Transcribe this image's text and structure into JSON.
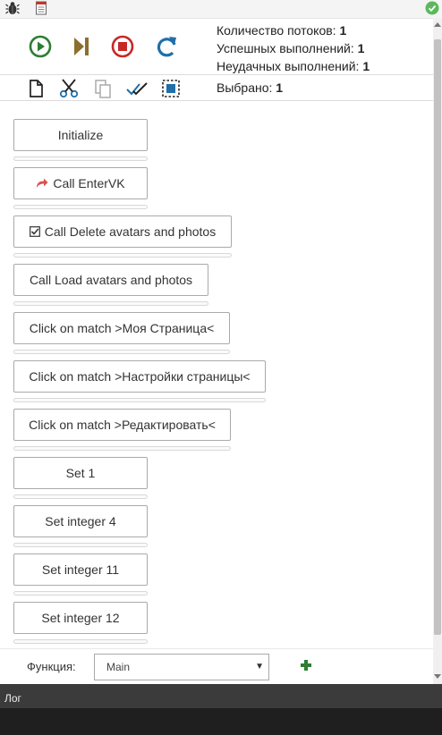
{
  "stats": {
    "threads_label": "Количество потоков:",
    "threads_value": "1",
    "success_label": "Успешных выполнений:",
    "success_value": "1",
    "fail_label": "Неудачных выполнений:",
    "fail_value": "1",
    "selected_label": "Выбрано:",
    "selected_value": "1"
  },
  "steps": [
    {
      "label": "Initialize",
      "icon": ""
    },
    {
      "label": "Call EnterVK",
      "icon": "share-arrow-icon"
    },
    {
      "label": "Call Delete avatars and photos",
      "icon": "checkbox-checked-icon"
    },
    {
      "label": "Call Load avatars and photos",
      "icon": ""
    },
    {
      "label": "Click on match >Моя Страница<",
      "icon": ""
    },
    {
      "label": "Click on match >Настройки страницы<",
      "icon": ""
    },
    {
      "label": "Click on match >Редактировать<",
      "icon": ""
    },
    {
      "label": "Set 1",
      "icon": ""
    },
    {
      "label": "Set integer 4",
      "icon": ""
    },
    {
      "label": "Set integer 11",
      "icon": ""
    },
    {
      "label": "Set integer 12",
      "icon": ""
    }
  ],
  "function_bar": {
    "label": "Функция:",
    "selected": "Main"
  },
  "log": {
    "title": "Лог"
  },
  "colors": {
    "play": "#2e7d32",
    "step": "#8d6e2c",
    "stop": "#c62828",
    "refresh": "#1f6fa8",
    "add": "#2e7d32",
    "arrow": "#d9534f",
    "ok": "#5cb85c"
  }
}
